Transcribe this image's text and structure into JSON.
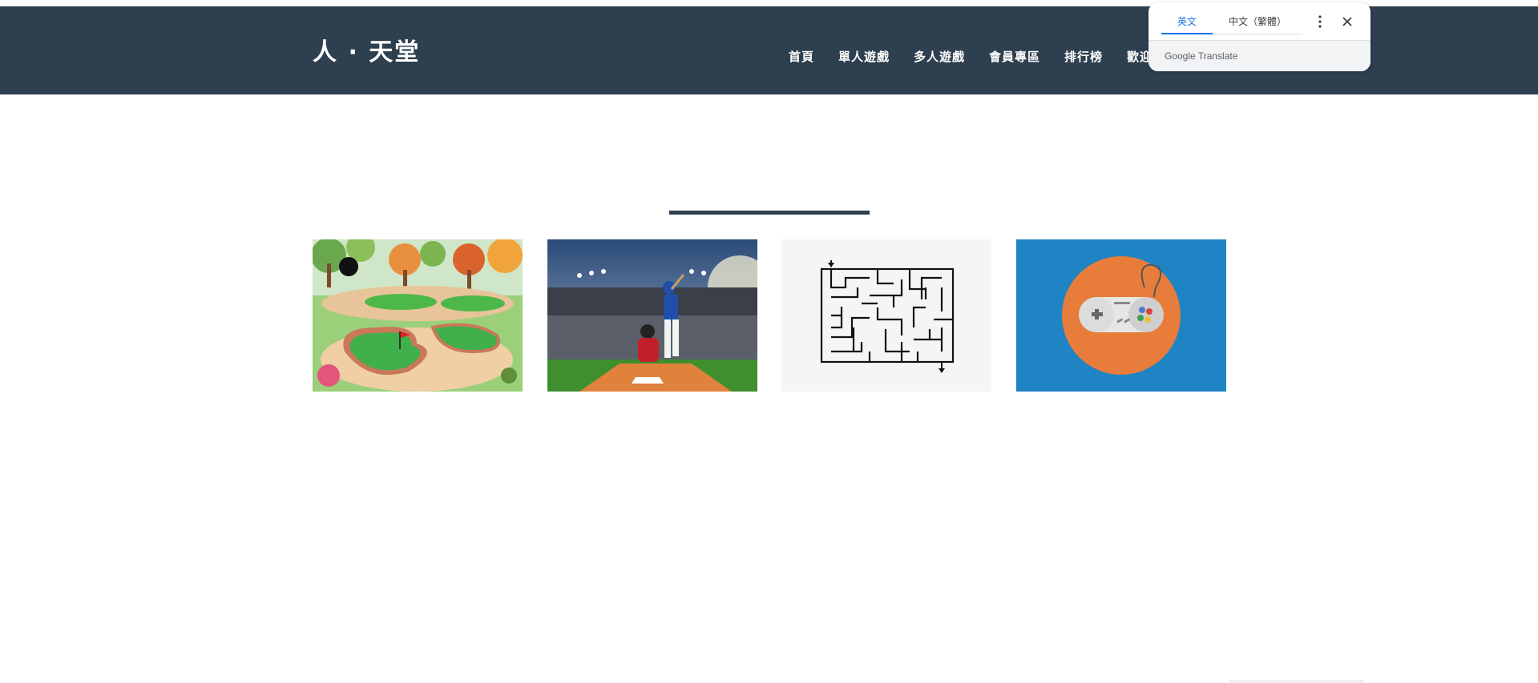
{
  "site": {
    "logo": "人 · 天堂"
  },
  "nav": [
    {
      "label": "首頁"
    },
    {
      "label": "單人遊戲"
    },
    {
      "label": "多人遊戲"
    },
    {
      "label": "會員專區"
    },
    {
      "label": "排行榜"
    },
    {
      "label": "歡迎"
    }
  ],
  "games": [
    {
      "name": "mini-golf",
      "icon": "mini-golf-course-image"
    },
    {
      "name": "baseball",
      "icon": "baseball-batter-image"
    },
    {
      "name": "maze",
      "icon": "maze-image"
    },
    {
      "name": "game-controller",
      "icon": "gamepad-image"
    }
  ],
  "translate_popup": {
    "tab_source": "英文",
    "tab_target": "中文（繁體）",
    "footer_brand": "Google",
    "footer_label": "Translate"
  },
  "colors": {
    "header_bg": "#2e3f50",
    "accent": "#1a73e8",
    "controller_bg": "#1e84c4",
    "controller_circle": "#e87c3a"
  }
}
